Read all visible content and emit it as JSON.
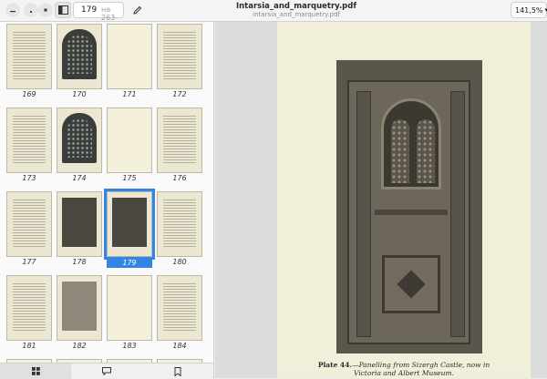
{
  "header": {
    "current_page": "179",
    "page_of": "на 263",
    "title": "Intarsia_and_marquetry.pdf",
    "subtitle": "intarsia_and_marquetry.pdf",
    "zoom": "141,5%",
    "icons": [
      "minimize-icon",
      "close-icon",
      "sidebar-toggle-icon",
      "annotate-pencil-icon",
      "chevron-down-icon"
    ]
  },
  "sidebar": {
    "selected_page": "179",
    "thumbnails": [
      {
        "label": "169",
        "kind": "text"
      },
      {
        "label": "170",
        "kind": "ornate"
      },
      {
        "label": "171",
        "kind": "blank"
      },
      {
        "label": "172",
        "kind": "text"
      },
      {
        "label": "173",
        "kind": "text"
      },
      {
        "label": "174",
        "kind": "ornate"
      },
      {
        "label": "175",
        "kind": "blank"
      },
      {
        "label": "176",
        "kind": "text"
      },
      {
        "label": "177",
        "kind": "text"
      },
      {
        "label": "178",
        "kind": "picture"
      },
      {
        "label": "179",
        "kind": "picture"
      },
      {
        "label": "180",
        "kind": "text"
      },
      {
        "label": "181",
        "kind": "text"
      },
      {
        "label": "182",
        "kind": "picture"
      },
      {
        "label": "183",
        "kind": "blank"
      },
      {
        "label": "184",
        "kind": "text"
      }
    ],
    "tabs": [
      {
        "name": "thumbnails-tab",
        "icon": "grid-icon"
      },
      {
        "name": "annotations-tab",
        "icon": "comment-icon"
      },
      {
        "name": "bookmarks-tab",
        "icon": "bookmark-icon"
      }
    ]
  },
  "document": {
    "caption_label": "Plate 44.",
    "caption_text": "—Panelling from Sizergh Castle, now in",
    "caption_line2": "Victoria and Albert Museum."
  }
}
